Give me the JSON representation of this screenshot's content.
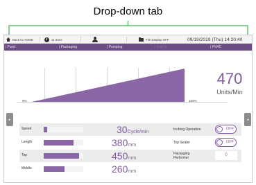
{
  "annotation": {
    "title": "Drop-down tab"
  },
  "status_bar": {
    "back_label": "Back to HOME",
    "timer_value": "11:4ons",
    "file_label": "File Display OFF",
    "datetime": "09/19/2019 (Thu) 14:20:40"
  },
  "nav": {
    "items": [
      {
        "label": "| Food"
      },
      {
        "label": "| Packaging"
      },
      {
        "label": "| Pumping"
      },
      {
        "label": "| End Sr"
      },
      {
        "label": "| HVAC"
      }
    ]
  },
  "production": {
    "value": "470",
    "unit": "Units/Min",
    "axis_min": "0%",
    "axis_max": "100%",
    "fill_fraction": 1.0
  },
  "rows": [
    {
      "label": "Speed",
      "value": "30",
      "unit": "Cycle/min",
      "level": 0.08
    },
    {
      "label": "Length",
      "value": "380",
      "unit": "mm",
      "level": 0.76
    },
    {
      "label": "Top",
      "value": "450",
      "unit": "mm",
      "level": 0.9
    },
    {
      "label": "Middle",
      "value": "260",
      "unit": "mm",
      "level": 0.52
    }
  ],
  "settings": {
    "inching_label": "Inching  Operation",
    "inching_state": "OFF",
    "top_sealer_label": "Top Sealer",
    "top_sealer_state": "OFF",
    "performer_label_1": "Packaging",
    "performer_label_2": "Performer",
    "performer_value": "0"
  },
  "colors": {
    "accent": "#7e5a9b",
    "nav_bg": "#6b4d86",
    "bar": "#8b66a6"
  }
}
